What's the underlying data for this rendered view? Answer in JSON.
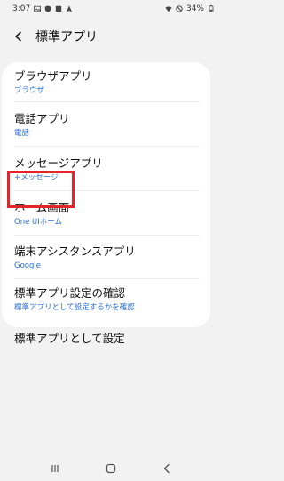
{
  "status_bar": {
    "time": "3:07",
    "battery": "34%",
    "left_icons": [
      "gallery-icon",
      "shield-icon",
      "notification-icon",
      "location-icon"
    ],
    "right_icons": [
      "wifi-icon",
      "dnd-icon",
      "battery-icon"
    ]
  },
  "header": {
    "title": "標準アプリ"
  },
  "list": {
    "items": [
      {
        "label": "ブラウザアプリ",
        "sub": "ブラウザ"
      },
      {
        "label": "電話アプリ",
        "sub": "電話"
      },
      {
        "label": "メッセージアプリ",
        "sub": "+メッセージ"
      },
      {
        "label": "ホーム画面",
        "sub": "One UIホーム"
      },
      {
        "label": "端末アシスタンスアプリ",
        "sub": "Google"
      },
      {
        "label": "標準アプリ設定の確認",
        "sub": "標準アプリとして設定するかを確認"
      },
      {
        "label": "標準アプリとして設定",
        "sub": ""
      }
    ]
  },
  "colors": {
    "accent": "#2a6fd6",
    "highlight": "#e0252b",
    "background": "#f2f2f2",
    "card": "#ffffff"
  },
  "navigation": {
    "buttons": [
      "recent-apps-icon",
      "home-icon",
      "back-icon"
    ]
  }
}
